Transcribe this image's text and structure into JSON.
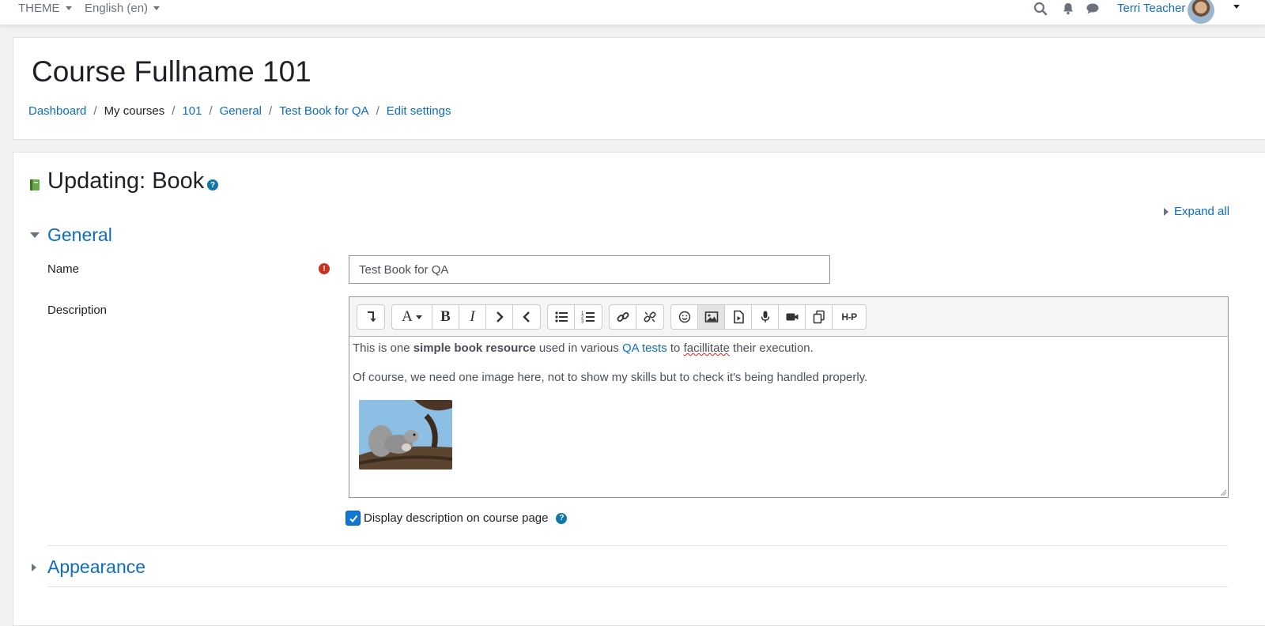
{
  "navbar": {
    "theme_label": "THEME",
    "language_label": "English (en)",
    "user_name": "Terri Teacher"
  },
  "header": {
    "course_title": "Course Fullname 101",
    "breadcrumb": [
      "Dashboard",
      "My courses",
      "101",
      "General",
      "Test Book for QA",
      "Edit settings"
    ]
  },
  "page": {
    "heading": "Updating: Book",
    "expand_all": "Expand all"
  },
  "sections": {
    "general": "General",
    "appearance": "Appearance"
  },
  "form": {
    "name_label": "Name",
    "name_value": "Test Book for QA",
    "description_label": "Description",
    "description": {
      "p1_before": "This is one ",
      "p1_bold": "simple book resource",
      "p1_middle": " used in various ",
      "p1_link": "QA tests",
      "p1_to": " to ",
      "p1_misspelled": "facillitate",
      "p1_after": " their execution.",
      "p2": "Of course, we need one image here, not to show my skills but to check it's being handled properly."
    },
    "display_description_label": "Display description on course page",
    "display_description_checked": true
  },
  "toolbar_icons": [
    "collapse",
    "font-style",
    "bold",
    "italic",
    "indent",
    "outdent",
    "unordered-list",
    "ordered-list",
    "link",
    "unlink",
    "emoticon",
    "image",
    "media",
    "record-audio",
    "record-video",
    "manage-files",
    "h5p"
  ],
  "colors": {
    "link": "#0f6cbf",
    "required": "#ca3120",
    "help": "#1177a8"
  }
}
